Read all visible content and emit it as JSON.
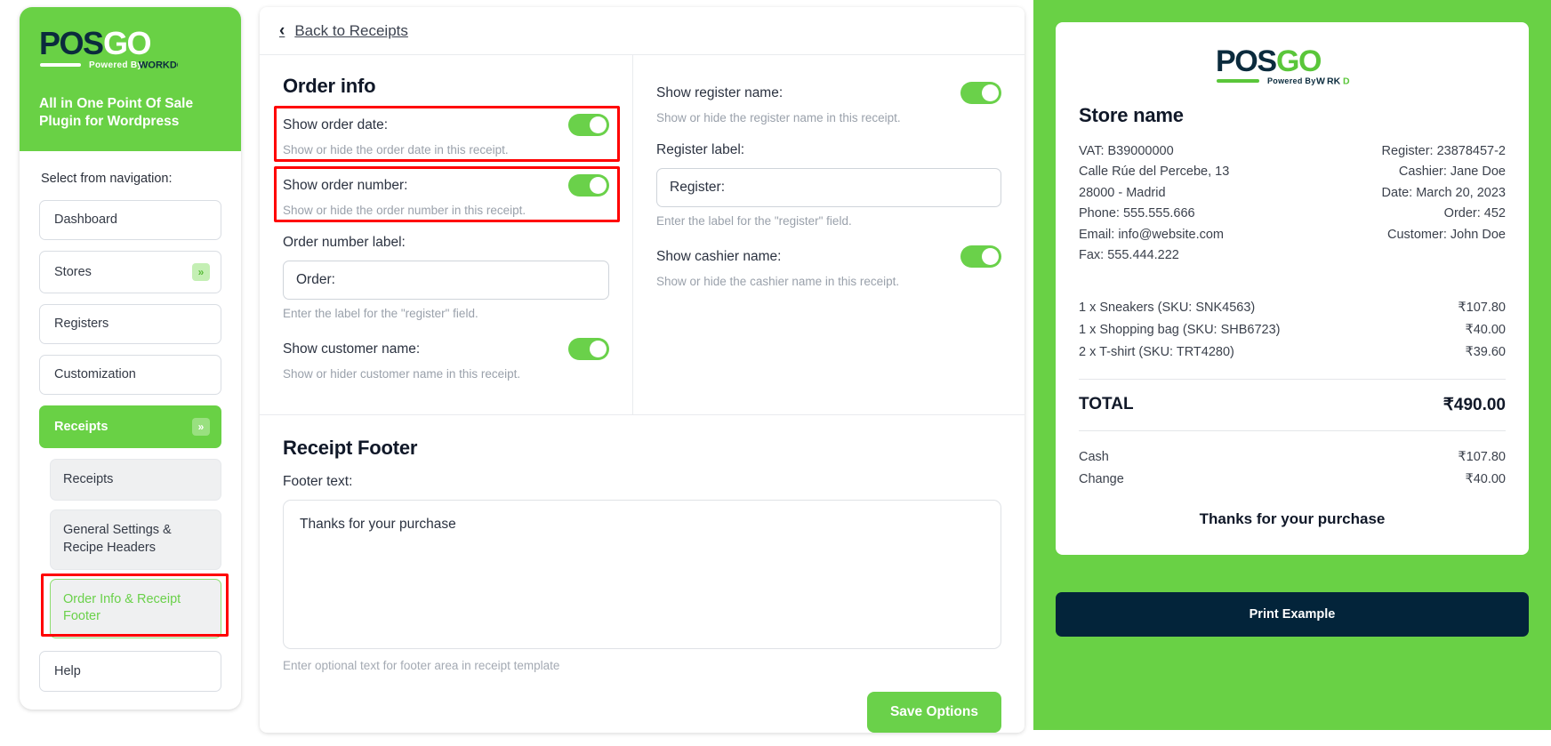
{
  "brand": {
    "logo_text_dark": "POS",
    "logo_text_light": "GO",
    "powered_by": "Powered By WORKDO",
    "tagline": "All in One Point Of Sale Plugin for Wordpress",
    "accent_green": "#69d145",
    "dark_navy": "#03243a",
    "highlight_red": "#ff0000"
  },
  "sidebar": {
    "nav_hint": "Select from navigation:",
    "items": [
      {
        "label": "Dashboard",
        "has_chevron": false,
        "active": false
      },
      {
        "label": "Stores",
        "has_chevron": true,
        "active": false
      },
      {
        "label": "Registers",
        "has_chevron": false,
        "active": false
      },
      {
        "label": "Customization",
        "has_chevron": false,
        "active": false
      },
      {
        "label": "Receipts",
        "has_chevron": true,
        "active": true
      }
    ],
    "chevron_glyph": "»",
    "sub_items": [
      {
        "label": "Receipts",
        "selected": false
      },
      {
        "label": "General Settings & Recipe Headers",
        "selected": false
      },
      {
        "label": "Order Info & Receipt Footer",
        "selected": true
      }
    ],
    "help_label": "Help"
  },
  "topbar": {
    "back_label": "Back to Receipts",
    "back_chevron": "‹"
  },
  "order_info": {
    "title": "Order info",
    "fields_left": [
      {
        "label": "Show order date:",
        "hint": "Show or hide the order date in this receipt.",
        "type": "toggle",
        "toggle_on": true,
        "highlighted": true
      },
      {
        "label": "Show order number:",
        "hint": "Show or hide the order number in this receipt.",
        "type": "toggle",
        "toggle_on": true,
        "highlighted": true
      },
      {
        "label": "Order number label:",
        "hint": "Enter the label for the \"register\" field.",
        "type": "input",
        "value": "Order:",
        "placeholder": "Order:",
        "highlighted": false
      },
      {
        "label": "Show customer name:",
        "hint": "Show or hider customer name in this receipt.",
        "type": "toggle",
        "toggle_on": true,
        "highlighted": false
      }
    ],
    "fields_right": [
      {
        "label": "Show register name:",
        "hint": "Show or hide the register name in this receipt.",
        "type": "toggle",
        "toggle_on": true,
        "highlighted": false
      },
      {
        "label": "Register label:",
        "hint": "Enter the label for the \"register\" field.",
        "type": "input",
        "value": "Register:",
        "placeholder": "Register:",
        "highlighted": false
      },
      {
        "label": "Show cashier name:",
        "hint": "Show or hide the cashier name in this receipt.",
        "type": "toggle",
        "toggle_on": true,
        "highlighted": false
      }
    ]
  },
  "receipt_footer": {
    "title": "Receipt Footer",
    "textarea_label": "Footer text:",
    "textarea_value": "Thanks for your purchase",
    "textarea_placeholder": "Thanks for your purchase",
    "textarea_hint": "Enter optional text for footer area in receipt template",
    "save_label": "Save Options"
  },
  "preview": {
    "store_name": "Store name",
    "left_meta": [
      "VAT: B39000000",
      "Calle Rúe del Percebe, 13",
      "28000 - Madrid",
      "Phone: 555.555.666",
      "Email: info@website.com",
      "Fax: 555.444.222"
    ],
    "right_meta": [
      "Register: 23878457-2",
      "Cashier: Jane Doe",
      "Date: March 20, 2023",
      "Order: 452",
      "Customer: John Doe"
    ],
    "line_items": [
      {
        "desc": "1 x Sneakers (SKU: SNK4563)",
        "amount": "₹107.80"
      },
      {
        "desc": "1 x Shopping bag (SKU: SHB6723)",
        "amount": "₹40.00"
      },
      {
        "desc": "2 x T-shirt (SKU: TRT4280)",
        "amount": "₹39.60"
      }
    ],
    "total_label": "TOTAL",
    "total_amount": "₹490.00",
    "payments": [
      {
        "label": "Cash",
        "amount": "₹107.80"
      },
      {
        "label": "Change",
        "amount": "₹40.00"
      }
    ],
    "thanks_text": "Thanks for your purchase",
    "print_label": "Print Example"
  }
}
